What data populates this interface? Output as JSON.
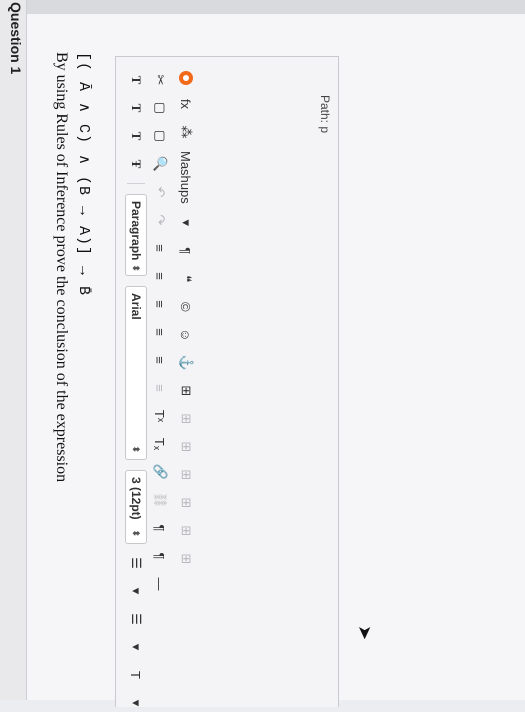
{
  "question": {
    "title": "Question 1",
    "prompt": "By using Rules of Inference prove the conclusion of the expression",
    "expression": "[( Ā ∧ C) ∧ (B → A)] → B̄"
  },
  "toolbar": {
    "row1": {
      "format_buttons": [
        "T",
        "T",
        "T",
        "Ŧ"
      ],
      "paragraph_label": "Paragraph",
      "font_label": "Arial",
      "size_label": "3 (12pt)",
      "list_bullets_glyph": "☰",
      "list_numbers_glyph": "☰",
      "text_color_glyph": "T"
    },
    "row2": {
      "cut_glyph": "✂",
      "copy_glyph": "▢",
      "paste_glyph": "▢",
      "find_glyph": "🔍",
      "undo_glyph": "↶",
      "redo_glyph": "↷",
      "align_glyphs": [
        "≡",
        "≡",
        "≡",
        "≡",
        "≡",
        "≡"
      ],
      "superscript_label": "Tˣ",
      "subscript_label": "Tₓ",
      "link_glyph": "🔗",
      "unlink_glyph": "⛓",
      "ltr_glyph": "¶",
      "rtl_glyph": "¶",
      "hr_glyph": "—"
    },
    "row3": {
      "fx_label": "fx",
      "mashups_label": "Mashups",
      "pilcrow_glyph": "¶",
      "quote_glyph": "❝",
      "copyright_glyph": "©",
      "emoji_glyph": "☺",
      "anchor_glyph": "⚓",
      "table_glyph": "⊞"
    }
  },
  "status": {
    "path_label": "Path: p"
  }
}
